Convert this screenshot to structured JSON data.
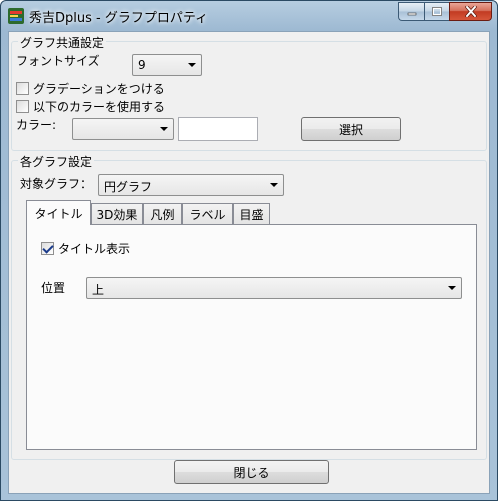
{
  "window": {
    "title": "秀吉Dplus - グラフプロパティ"
  },
  "common_group": {
    "legend": "グラフ共通設定",
    "font_size_label": "フォントサイズ",
    "font_size_value": "9",
    "gradient_label": "グラデーションをつける",
    "gradient_checked": false,
    "use_color_label": "以下のカラーを使用する",
    "use_color_checked": false,
    "color_label": "カラー:",
    "color_value": "",
    "color_text": "",
    "select_button": "選択"
  },
  "each_group": {
    "legend": "各グラフ設定",
    "target_label": "対象グラフ：",
    "target_value": "円グラフ",
    "tabs": [
      "タイトル",
      "3D効果",
      "凡例",
      "ラベル",
      "目盛"
    ],
    "active_tab": "タイトル",
    "title_show_label": "タイトル表示",
    "title_show_checked": true,
    "position_label": "位置",
    "position_value": "上"
  },
  "footer": {
    "close_button": "閉じる"
  },
  "icons": {
    "app": "hidekichi-app-icon",
    "minimize": "minimize-icon",
    "maximize": "maximize-icon",
    "close": "close-icon"
  }
}
